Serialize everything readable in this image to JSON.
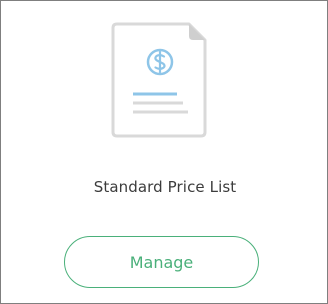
{
  "card": {
    "icon": "price-document-icon",
    "title": "Standard Price List",
    "manage_label": "Manage"
  },
  "colors": {
    "accent": "#4ab07a",
    "icon_blue": "#8ec5e8",
    "icon_gray": "#d9d9d9",
    "title": "#3c3c3c",
    "border": "#7f7f7f"
  }
}
